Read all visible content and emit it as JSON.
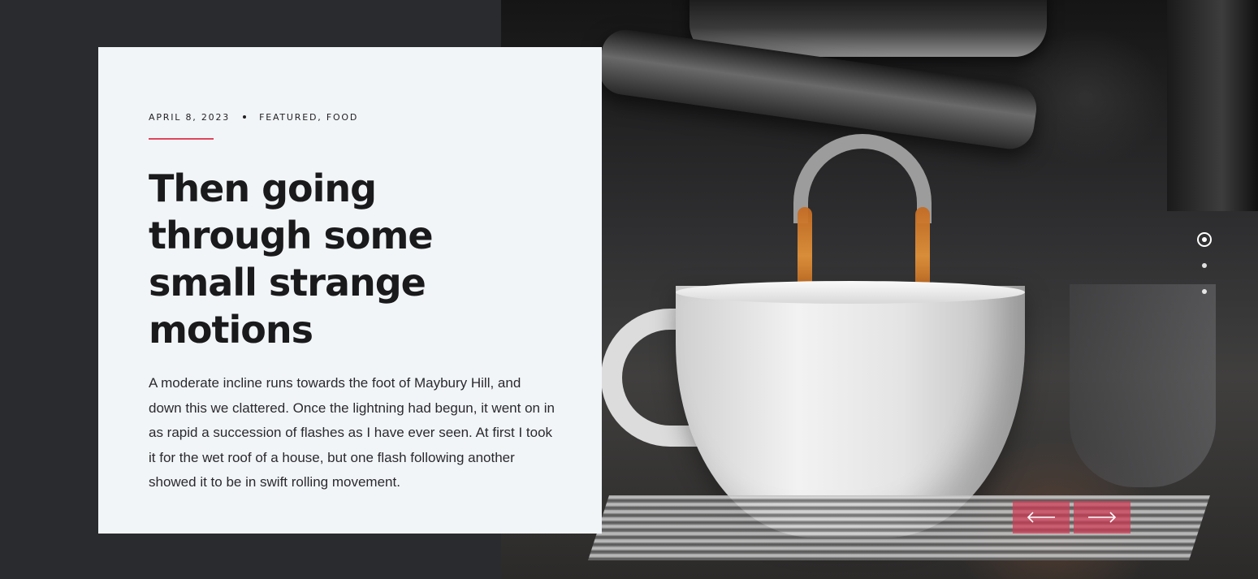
{
  "post": {
    "date": "APRIL 8, 2023",
    "categories": [
      "FEATURED",
      "FOOD"
    ],
    "title": "Then going through some small strange motions",
    "excerpt": "A moderate incline runs towards the foot of Maybury Hill, and down this we clattered. Once the lightning had begun, it went on in as rapid a succession of flashes as I have ever seen. At first I took it for the wet roof of a house, but one flash following another showed it to be in swift rolling movement."
  },
  "slider": {
    "active_index": 0,
    "slide_count": 3,
    "prev_icon": "arrow-left-icon",
    "next_icon": "arrow-right-icon"
  },
  "colors": {
    "page_background": "#2a2b2f",
    "card_background": "#f2f5f8",
    "accent": "#e0455b",
    "nav_button": "#cf3a54"
  }
}
